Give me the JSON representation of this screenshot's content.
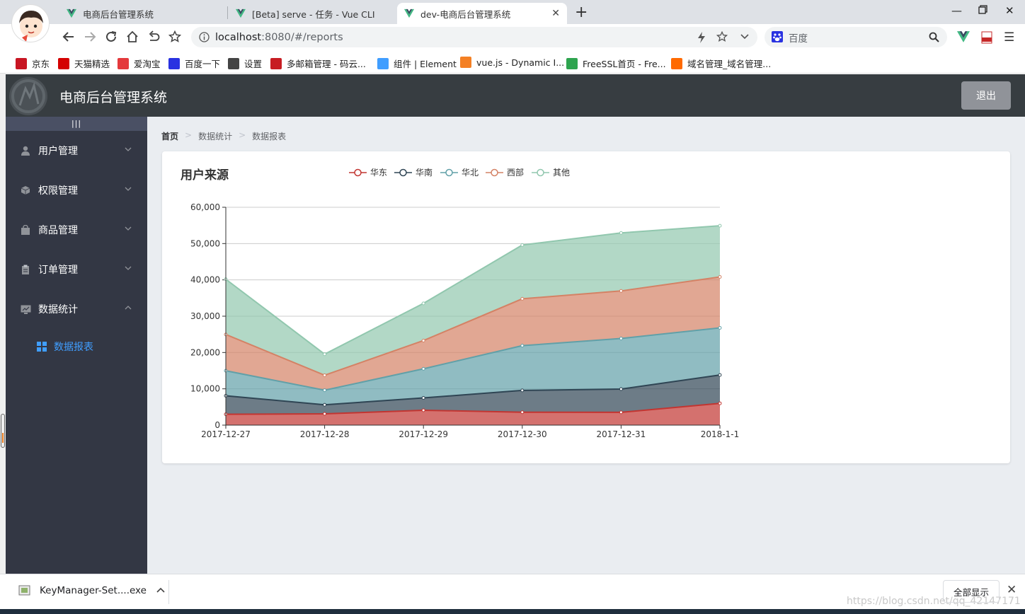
{
  "browser": {
    "tabs": [
      {
        "label": "电商后台管理系统"
      },
      {
        "label": "[Beta] serve - 任务 - Vue CLI"
      },
      {
        "label": "dev-电商后台管理系统"
      }
    ],
    "new_tab_label": "+",
    "url_host": "localhost",
    "url_rest": ":8080/#/reports",
    "search_placeholder": "百度",
    "bookmarks": [
      {
        "label": "京东",
        "icon": "jd-icon",
        "color": "#c81623"
      },
      {
        "label": "天猫精选",
        "icon": "tmall-icon",
        "color": "#d40000"
      },
      {
        "label": "爱淘宝",
        "icon": "taobao-icon",
        "color": "#e4393c"
      },
      {
        "label": "百度一下",
        "icon": "baidu-icon",
        "color": "#2932e1"
      },
      {
        "label": "设置",
        "icon": "gear-icon",
        "color": "#444444"
      },
      {
        "label": "多邮箱管理 - 码云...",
        "icon": "gitee-icon",
        "color": "#c71d23"
      },
      {
        "label": "组件 | Element",
        "icon": "element-icon",
        "color": "#409eff"
      },
      {
        "label": "vue.js - Dynamic I...",
        "icon": "stackoverflow-icon",
        "color": "#f48024"
      },
      {
        "label": "FreeSSL首页 - Fre...",
        "icon": "lock-icon",
        "color": "#2ea44f"
      },
      {
        "label": "域名管理_域名管理...",
        "icon": "aliyun-icon",
        "color": "#ff6a00"
      }
    ]
  },
  "app": {
    "title": "电商后台管理系统",
    "logout_label": "退出",
    "toggle_label": "|||",
    "menu": [
      {
        "label": "用户管理",
        "icon": "user-icon"
      },
      {
        "label": "权限管理",
        "icon": "box-icon"
      },
      {
        "label": "商品管理",
        "icon": "bag-icon"
      },
      {
        "label": "订单管理",
        "icon": "clipboard-icon"
      },
      {
        "label": "数据统计",
        "icon": "chart-icon"
      }
    ],
    "submenu": {
      "label": "数据报表",
      "icon": "grid-icon"
    },
    "breadcrumb": [
      "首页",
      "数据统计",
      "数据报表"
    ]
  },
  "chart_data": {
    "type": "area",
    "stacked": true,
    "title": "用户来源",
    "legend_position": "top",
    "x": [
      "2017-12-27",
      "2017-12-28",
      "2017-12-29",
      "2017-12-30",
      "2017-12-31",
      "2018-1-1"
    ],
    "ylim": [
      0,
      60000
    ],
    "yticks": [
      "0",
      "10,000",
      "20,000",
      "30,000",
      "40,000",
      "50,000",
      "60,000"
    ],
    "grid": true,
    "series": [
      {
        "name": "华东",
        "color": "#c23531",
        "values": [
          2999,
          3111,
          4100,
          3565,
          3528,
          6000
        ]
      },
      {
        "name": "华南",
        "color": "#2f4554",
        "values": [
          5090,
          2500,
          3400,
          6000,
          6400,
          7800
        ]
      },
      {
        "name": "华北",
        "color": "#61a0a8",
        "values": [
          6888,
          4000,
          8010,
          12321,
          13928,
          12984
        ]
      },
      {
        "name": "西部",
        "color": "#d48265",
        "values": [
          9991,
          4130,
          7777,
          12903,
          13098,
          14028
        ]
      },
      {
        "name": "其他",
        "color": "#91c7ae",
        "values": [
          15212,
          5800,
          10241,
          14821,
          15982,
          14091
        ]
      }
    ]
  },
  "downloads": {
    "file_label": "KeyManager-Set....exe",
    "show_all_label": "全部显示",
    "watermark": "https://blog.csdn.net/qq_42147171"
  }
}
